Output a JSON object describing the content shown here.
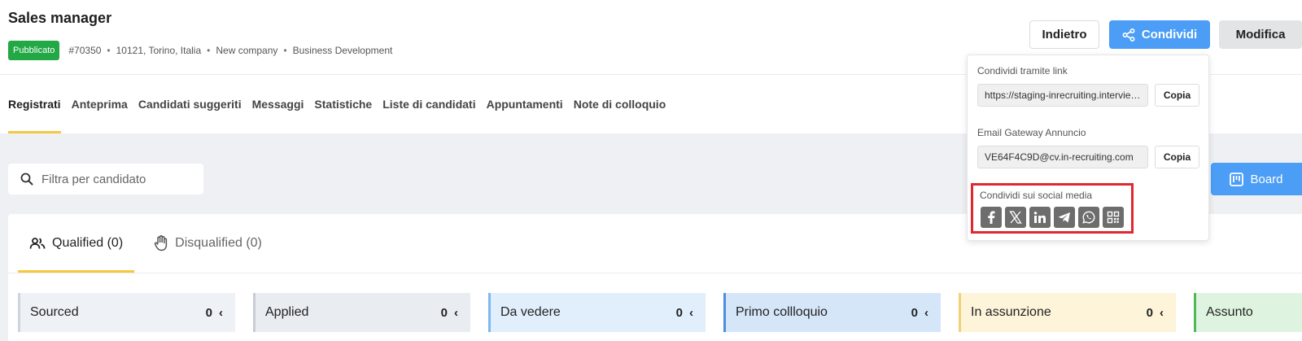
{
  "header": {
    "title": "Sales manager",
    "status": "Pubblicato",
    "meta": [
      "#70350",
      "10121, Torino, Italia",
      "New company",
      "Business Development"
    ],
    "separator": "•",
    "back_label": "Indietro",
    "share_label": "Condividi",
    "edit_label": "Modifica"
  },
  "tabs": [
    {
      "label": "Registrati",
      "active": true
    },
    {
      "label": "Anteprima"
    },
    {
      "label": "Candidati suggeriti"
    },
    {
      "label": "Messaggi"
    },
    {
      "label": "Statistiche"
    },
    {
      "label": "Liste di candidati"
    },
    {
      "label": "Appuntamenti"
    },
    {
      "label": "Note di colloquio"
    }
  ],
  "filter": {
    "placeholder": "Filtra per candidato"
  },
  "board_label": "Board",
  "qualification_tabs": [
    {
      "label": "Qualified (0)",
      "icon": "people-icon",
      "active": true
    },
    {
      "label": "Disqualified (0)",
      "icon": "hand-icon",
      "active": false
    }
  ],
  "stages": [
    {
      "label": "Sourced",
      "count": "0",
      "bg": "#eef1f6",
      "border": "#d0d5dd"
    },
    {
      "label": "Applied",
      "count": "0",
      "bg": "#e9ecf1",
      "border": "#c8ccd4"
    },
    {
      "label": "Da vedere",
      "count": "0",
      "bg": "#e1effc",
      "border": "#7fb6ee"
    },
    {
      "label": "Primo collloquio",
      "count": "0",
      "bg": "#d6e6f9",
      "border": "#4b8fe0"
    },
    {
      "label": "In assunzione",
      "count": "0",
      "bg": "#fdf4d9",
      "border": "#f0d27a"
    },
    {
      "label": "Assunto",
      "count": "",
      "bg": "#dff4e0",
      "border": "#4fb858"
    }
  ],
  "share": {
    "link_label": "Condividi tramite link",
    "link_value": "https://staging-inrecruiting.intervieweb.it/annunci",
    "email_label": "Email Gateway Annuncio",
    "email_value": "VE64F4C9D@cv.in-recruiting.com",
    "copy_label": "Copia",
    "social_label": "Condividi sui social media",
    "social": [
      "facebook-icon",
      "x-icon",
      "linkedin-icon",
      "telegram-icon",
      "whatsapp-icon",
      "qr-code-icon"
    ]
  },
  "colors": {
    "accent": "#4b9df5",
    "published": "#22a845",
    "active_tab": "#f5c842",
    "highlight": "#e0282e"
  }
}
